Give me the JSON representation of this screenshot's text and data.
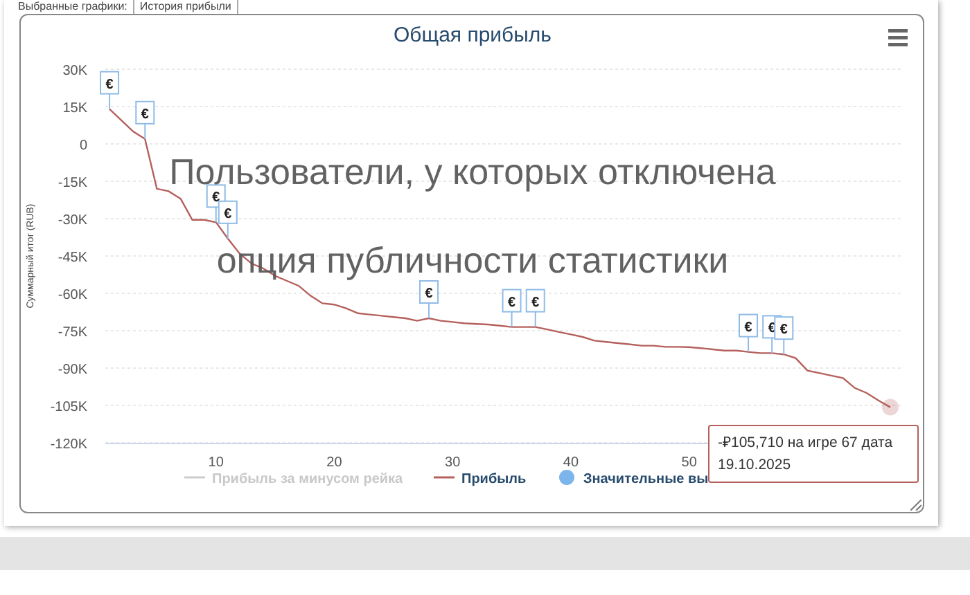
{
  "selector": {
    "label": "Выбранные графики:",
    "value": "История прибыли"
  },
  "chart": {
    "overlay_message": [
      "Пользователи, у которых отключена",
      "опция публичности статистики"
    ],
    "legend": [
      {
        "kind": "line",
        "label": "Прибыль за минусом рейка",
        "visible": false
      },
      {
        "kind": "series",
        "visible": true
      },
      {
        "kind": "dot",
        "label": "Значительные вы",
        "visible": true,
        "color": "#7cb5ec"
      }
    ],
    "tooltip": "-₽105,710 на игре 67 дата 19.10.2025",
    "chart_data": {
      "type": "line",
      "title": "Общая прибыль",
      "ylabel": "Суммарный итог (RUB)",
      "grid": true,
      "x": [
        1,
        2,
        3,
        4,
        5,
        6,
        7,
        8,
        9,
        10,
        11,
        12,
        13,
        14,
        15,
        16,
        17,
        18,
        19,
        20,
        21,
        22,
        23,
        24,
        25,
        26,
        27,
        28,
        29,
        30,
        31,
        32,
        33,
        34,
        35,
        36,
        37,
        38,
        39,
        40,
        41,
        42,
        43,
        44,
        45,
        46,
        47,
        48,
        49,
        50,
        51,
        52,
        53,
        54,
        55,
        56,
        57,
        58,
        59,
        60,
        61,
        62,
        63,
        64,
        65,
        66,
        67
      ],
      "series": [
        {
          "name": "Прибыль",
          "color": "#b5605c",
          "values": [
            14000,
            9500,
            5000,
            2000,
            -18000,
            -19000,
            -22000,
            -30500,
            -30500,
            -31500,
            -38000,
            -44000,
            -48000,
            -50000,
            -53000,
            -55000,
            -57000,
            -61000,
            -64000,
            -64500,
            -66000,
            -68000,
            -68500,
            -69000,
            -69500,
            -70000,
            -71000,
            -70000,
            -71000,
            -71500,
            -72000,
            -72300,
            -72500,
            -73000,
            -73500,
            -73500,
            -73500,
            -74500,
            -75500,
            -76500,
            -77500,
            -79000,
            -79500,
            -80000,
            -80500,
            -81000,
            -81000,
            -81500,
            -81500,
            -81600,
            -82000,
            -82500,
            -83000,
            -83000,
            -83500,
            -84000,
            -84000,
            -84500,
            -86000,
            -91000,
            -92000,
            -93000,
            -94000,
            -98000,
            -100000,
            -103000,
            -105700
          ]
        }
      ],
      "ylim": [
        -120000,
        30000
      ],
      "xlim": [
        0,
        68
      ],
      "xticks": [
        10,
        20,
        30,
        40,
        50
      ],
      "yticks": [
        {
          "value": 30000,
          "label": "30K"
        },
        {
          "value": 15000,
          "label": "15K"
        },
        {
          "value": 0,
          "label": "0"
        },
        {
          "value": -15000,
          "label": "-15K"
        },
        {
          "value": -30000,
          "label": "-30K"
        },
        {
          "value": -45000,
          "label": "-45K"
        },
        {
          "value": -60000,
          "label": "-60K"
        },
        {
          "value": -75000,
          "label": "-75K"
        },
        {
          "value": -90000,
          "label": "-90K"
        },
        {
          "value": -105000,
          "label": "-105K"
        },
        {
          "value": -120000,
          "label": "-120K"
        }
      ],
      "annotations": [
        {
          "x": 1,
          "y": 14000,
          "text": "€"
        },
        {
          "x": 4,
          "y": 2000,
          "text": "€"
        },
        {
          "x": 10,
          "y": -31500,
          "text": "€"
        },
        {
          "x": 11,
          "y": -38000,
          "text": "€"
        },
        {
          "x": 28,
          "y": -70000,
          "text": "€"
        },
        {
          "x": 35,
          "y": -73500,
          "text": "€"
        },
        {
          "x": 37,
          "y": -73500,
          "text": "€"
        },
        {
          "x": 55,
          "y": -83500,
          "text": "€"
        },
        {
          "x": 57,
          "y": -84000,
          "text": "€"
        },
        {
          "x": 58,
          "y": -84500,
          "text": "€"
        }
      ]
    }
  }
}
